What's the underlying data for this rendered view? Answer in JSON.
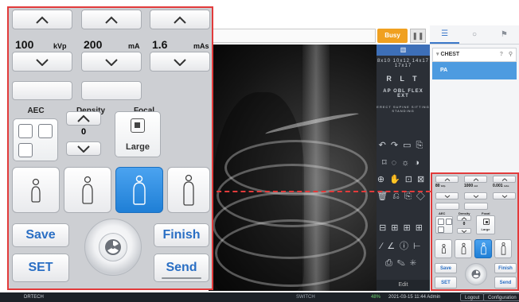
{
  "toolbar": {
    "busy_label": "Busy",
    "pause_icon": "pause-icon"
  },
  "tools": {
    "sizes": "8x10 10x12 14x17 17x17",
    "markers": "R L T",
    "views": "AP OBL FLEX EXT",
    "positions": "ERECT SUPINE SITTING STANDING",
    "edit_label": "Edit"
  },
  "right_panel": {
    "tabs": [
      "list-icon",
      "circle-icon",
      "flag-icon"
    ],
    "body_part": "CHEST",
    "help": "?",
    "view": "PA"
  },
  "status": {
    "brand": "DRTECH",
    "switch": "SWITCH",
    "battery": "48%",
    "datetime": "2021-03-15 11:44 Admin",
    "logout": "Logout",
    "config": "Configuration"
  },
  "exposure": {
    "kvp_value": "100",
    "kvp_unit": "kVp",
    "ma_value": "200",
    "ma_unit": "mA",
    "mas_value": "1.6",
    "mas_unit": "mAs",
    "aec_label": "AEC",
    "density_label": "Density",
    "density_value": "0",
    "focal_label": "Focal",
    "focal_value": "Large",
    "save_label": "Save",
    "finish_label": "Finish",
    "set_label": "SET",
    "send_label": "Send"
  },
  "mini": {
    "kvp_value": "80",
    "kvp_unit": "kVp",
    "ma_value": "1000",
    "ma_unit": "mA",
    "mas_value": "0.001",
    "mas_unit": "mAs",
    "aec_label": "AEC",
    "density_label": "Density",
    "density_value": "0",
    "focal_label": "Focal",
    "focal_value": "Large",
    "save_label": "Save",
    "finish_label": "Finish",
    "set_label": "SET",
    "send_label": "Send"
  },
  "colors": {
    "accent": "#2a6fc4",
    "highlight": "#e23b3b",
    "busy": "#f0a020"
  }
}
